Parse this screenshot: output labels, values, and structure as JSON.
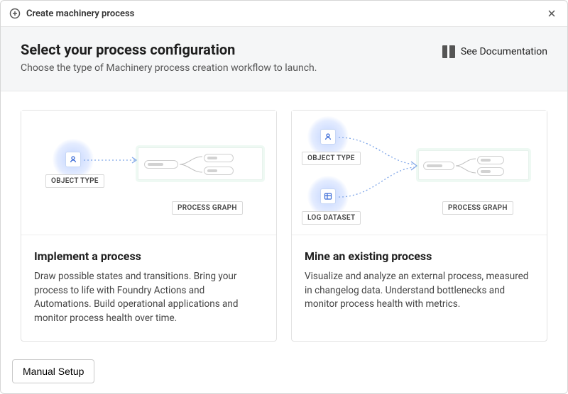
{
  "dialog": {
    "title": "Create machinery process"
  },
  "header": {
    "title": "Select your process configuration",
    "subtitle": "Choose the type of Machinery process creation workflow to launch.",
    "doc_link": "See Documentation"
  },
  "cards": {
    "implement": {
      "title": "Implement a process",
      "body": "Draw possible states and transitions. Bring your process to life with Foundry Actions and Automations. Build operational applications and monitor process health over time.",
      "illus": {
        "object_type_label": "OBJECT TYPE",
        "process_graph_label": "PROCESS GRAPH"
      }
    },
    "mine": {
      "title": "Mine an existing process",
      "body": "Visualize and analyze an external process, measured in changelog data. Understand bottlenecks and monitor process health with metrics.",
      "illus": {
        "object_type_label": "OBJECT TYPE",
        "log_dataset_label": "LOG DATASET",
        "process_graph_label": "PROCESS GRAPH"
      }
    }
  },
  "footer": {
    "manual_setup": "Manual Setup"
  }
}
